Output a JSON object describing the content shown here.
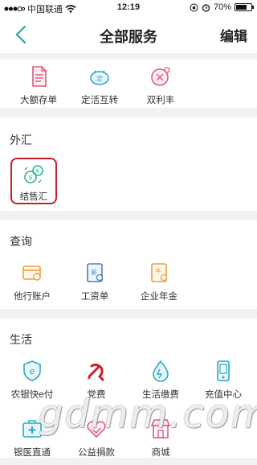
{
  "status_bar": {
    "carrier": "中国联通",
    "time": "12:19",
    "battery": "70%",
    "battery_level": 0.7
  },
  "nav": {
    "title": "全部服务",
    "edit_label": "编辑"
  },
  "deposit": {
    "items": [
      {
        "label": "大额存单",
        "icon": "certificate-doc-icon",
        "color": "#e05a7a"
      },
      {
        "label": "定活互转",
        "icon": "piggy-bank-icon",
        "color": "#2aa9c8"
      },
      {
        "label": "双利丰",
        "icon": "coin-icon",
        "color": "#e05a7a"
      }
    ]
  },
  "forex": {
    "title": "外汇",
    "items": [
      {
        "label": "结售汇",
        "icon": "currency-exchange-icon",
        "color": "#2bb594"
      }
    ],
    "highlight_color": "#c8202c"
  },
  "query": {
    "title": "查询",
    "items": [
      {
        "label": "他行账户",
        "icon": "bank-card-icon",
        "color": "#e8a23a"
      },
      {
        "label": "工资单",
        "icon": "payslip-icon",
        "color": "#4a7fc8"
      },
      {
        "label": "企业年金",
        "icon": "annuity-doc-icon",
        "color": "#e8a23a"
      }
    ]
  },
  "life": {
    "title": "生活",
    "items": [
      {
        "label": "农银快e付",
        "icon": "e-pay-shield-icon",
        "color": "#2aa9c8"
      },
      {
        "label": "党费",
        "icon": "party-emblem-icon",
        "color": "#c8202c"
      },
      {
        "label": "生活缴费",
        "icon": "water-drop-icon",
        "color": "#2aa9c8"
      },
      {
        "label": "充值中心",
        "icon": "phone-topup-icon",
        "color": "#2aa9c8"
      },
      {
        "label": "银医直通",
        "icon": "medical-kit-icon",
        "color": "#2aa9c8"
      },
      {
        "label": "公益捐款",
        "icon": "heart-hands-icon",
        "color": "#e05a7a"
      },
      {
        "label": "商城",
        "icon": "store-icon",
        "color": "#e05a7a"
      }
    ]
  },
  "watermark": "gdmm.com"
}
